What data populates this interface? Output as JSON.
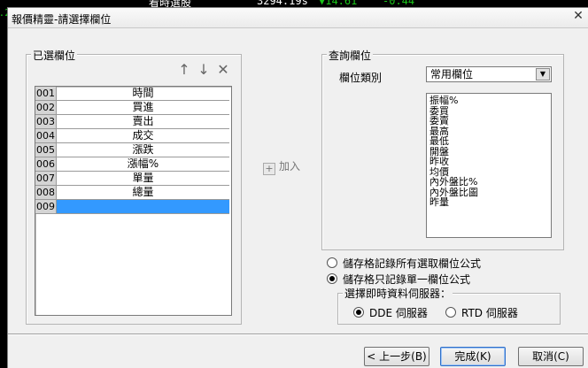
{
  "background": {
    "top_strip": [
      {
        "text": "看時選股",
        "color": "#ffffff"
      },
      {
        "text": "3294.19s",
        "color": "#ffffff"
      },
      {
        "text": "▼14.61",
        "color": "#19c219"
      },
      {
        "text": "-0.44",
        "color": "#19c219"
      }
    ],
    "left_strip": [
      "0.28",
      "",
      "",
      "",
      "",
      "",
      "",
      "",
      "",
      "",
      "",
      "",
      "",
      "",
      "",
      "",
      "",
      ""
    ]
  },
  "dialog": {
    "title": "報價精靈-請選擇欄位",
    "close_symbol": "✕"
  },
  "selected_fields": {
    "legend": "已選欄位",
    "tools": {
      "up": "↑",
      "down": "↓",
      "remove": "✕"
    },
    "rows": [
      {
        "num": "001",
        "name": "時間"
      },
      {
        "num": "002",
        "name": "買進"
      },
      {
        "num": "003",
        "name": "賣出"
      },
      {
        "num": "004",
        "name": "成交"
      },
      {
        "num": "005",
        "name": "漲跌"
      },
      {
        "num": "006",
        "name": "漲幅%"
      },
      {
        "num": "007",
        "name": "單量"
      },
      {
        "num": "008",
        "name": "總量"
      },
      {
        "num": "009",
        "name": ""
      }
    ],
    "selected_row_index": 8
  },
  "add_button": {
    "label": "加入",
    "icon": "+"
  },
  "query_fields": {
    "legend": "查詢欄位",
    "category_label": "欄位類別",
    "category_value": "常用欄位",
    "dropdown_arrow": "▼",
    "items": [
      "振幅%",
      "委買",
      "委賣",
      "最高",
      "最低",
      "開盤",
      "昨收",
      "均價",
      "內外盤比%",
      "內外盤比圖",
      "昨量"
    ]
  },
  "storage": {
    "all_formula": "儲存格記錄所有選取欄位公式",
    "single_formula": "儲存格只記錄單一欄位公式",
    "selected": "single"
  },
  "server": {
    "legend": "選擇即時資料伺服器：",
    "dde": "DDE 伺服器",
    "rtd": "RTD 伺服器",
    "selected": "dde"
  },
  "buttons": {
    "back": "< 上一步(B)",
    "finish": "完成(K)",
    "cancel": "取消(C)"
  }
}
